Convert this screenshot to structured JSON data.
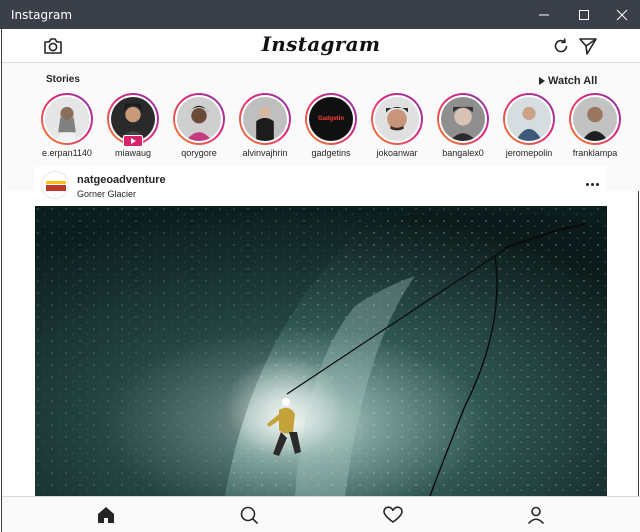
{
  "window": {
    "title": "Instagram",
    "minimize_icon": "minimize-icon",
    "maximize_icon": "maximize-icon",
    "close_icon": "close-icon"
  },
  "topnav": {
    "logo": "Instagram",
    "camera_icon": "camera-icon",
    "refresh_icon": "refresh-icon",
    "direct_icon": "send-icon"
  },
  "stories": {
    "label": "Stories",
    "watch_all": "Watch All",
    "items": [
      {
        "username": "e.erpan1140",
        "live": false,
        "bg": "#d9d9d9"
      },
      {
        "username": "miawaug",
        "live": true,
        "bg": "#2a2a2a"
      },
      {
        "username": "qorygore",
        "live": false,
        "bg": "#c9c9c9"
      },
      {
        "username": "alvinvajhrin",
        "live": false,
        "bg": "#b8b8b8"
      },
      {
        "username": "gadgetins",
        "live": false,
        "bg": "#101010",
        "logo_text": "Gadgetin"
      },
      {
        "username": "jokoanwar",
        "live": false,
        "bg": "#d0d0d0"
      },
      {
        "username": "bangalex0",
        "live": false,
        "bg": "#a8a8a8"
      },
      {
        "username": "jeromepolin",
        "live": false,
        "bg": "#cfcfcf"
      },
      {
        "username": "franklampa",
        "live": false,
        "bg": "#bdbdbd"
      }
    ]
  },
  "post": {
    "username": "natgeoadventure",
    "location": "Gorner Glacier",
    "avatar_text": "NATIONAL GEOGRAPHIC ADVENTURE",
    "more_icon": "more-options-icon"
  },
  "bottomnav": {
    "items": [
      {
        "icon": "home-icon",
        "active": true
      },
      {
        "icon": "search-icon",
        "active": false
      },
      {
        "icon": "heart-icon",
        "active": false
      },
      {
        "icon": "profile-icon",
        "active": false
      }
    ]
  },
  "colors": {
    "story_ring_start": "#f58529",
    "story_ring_end": "#8134af",
    "live_badge": "#d6236a",
    "titlebar": "#3b3f4a"
  }
}
